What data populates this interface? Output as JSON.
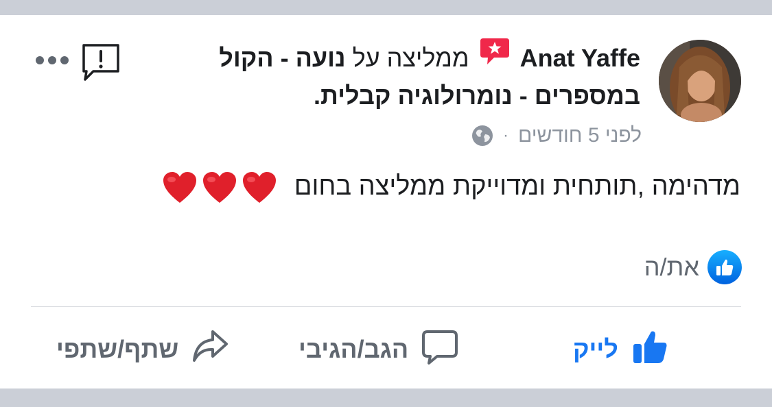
{
  "post": {
    "author_name": "Anat Yaffe",
    "verb": "ממליצה על",
    "page_name": "נועה - הקול במספרים - נומרולוגיה קבלית.",
    "timestamp": "לפני 5 חודשים",
    "separator": "·",
    "body": "מדהימה ,תותחית ומדוייקת ממליצה בחום",
    "reactions_label": "את/ה"
  },
  "actions": {
    "like_label": "לייק",
    "comment_label": "הגב/הגיבי",
    "share_label": "שתף/שתפי"
  },
  "icons": {
    "recommendation": "recommendation-star-icon",
    "privacy": "globe-icon",
    "report": "report-icon",
    "more": "more-options-icon",
    "hearts": "red-heart-icon",
    "like": "thumbs-up-icon",
    "comment": "comment-bubble-icon",
    "share": "share-arrow-icon"
  },
  "colors": {
    "brand_blue": "#1877f2",
    "recommend_red": "#f0284a",
    "text_primary": "#1c1e21",
    "text_secondary": "#606770",
    "meta_gray": "#8d949e",
    "band_gray": "#cbcfd7"
  }
}
